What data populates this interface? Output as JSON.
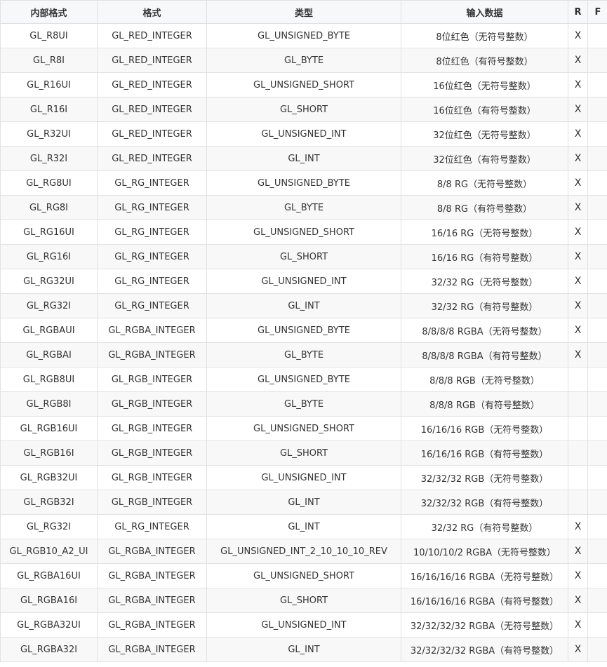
{
  "table": {
    "headers": [
      "内部格式",
      "格式",
      "类型",
      "输入数据",
      "R",
      "F"
    ],
    "rows": [
      [
        "GL_R8UI",
        "GL_RED_INTEGER",
        "GL_UNSIGNED_BYTE",
        "8位红色（无符号整数）",
        "X",
        ""
      ],
      [
        "GL_R8I",
        "GL_RED_INTEGER",
        "GL_BYTE",
        "8位红色（有符号整数）",
        "X",
        ""
      ],
      [
        "GL_R16UI",
        "GL_RED_INTEGER",
        "GL_UNSIGNED_SHORT",
        "16位红色（无符号整数）",
        "X",
        ""
      ],
      [
        "GL_R16I",
        "GL_RED_INTEGER",
        "GL_SHORT",
        "16位红色（有符号整数）",
        "X",
        ""
      ],
      [
        "GL_R32UI",
        "GL_RED_INTEGER",
        "GL_UNSIGNED_INT",
        "32位红色（无符号整数）",
        "X",
        ""
      ],
      [
        "GL_R32I",
        "GL_RED_INTEGER",
        "GL_INT",
        "32位红色（有符号整数）",
        "X",
        ""
      ],
      [
        "GL_RG8UI",
        "GL_RG_INTEGER",
        "GL_UNSIGNED_BYTE",
        "8/8 RG（无符号整数）",
        "X",
        ""
      ],
      [
        "GL_RG8I",
        "GL_RG_INTEGER",
        "GL_BYTE",
        "8/8 RG（有符号整数）",
        "X",
        ""
      ],
      [
        "GL_RG16UI",
        "GL_RG_INTEGER",
        "GL_UNSIGNED_SHORT",
        "16/16 RG（无符号整数）",
        "X",
        ""
      ],
      [
        "GL_RG16I",
        "GL_RG_INTEGER",
        "GL_SHORT",
        "16/16 RG（有符号整数）",
        "X",
        ""
      ],
      [
        "GL_RG32UI",
        "GL_RG_INTEGER",
        "GL_UNSIGNED_INT",
        "32/32 RG（无符号整数）",
        "X",
        ""
      ],
      [
        "GL_RG32I",
        "GL_RG_INTEGER",
        "GL_INT",
        "32/32 RG（有符号整数）",
        "X",
        ""
      ],
      [
        "GL_RGBAUI",
        "GL_RGBA_INTEGER",
        "GL_UNSIGNED_BYTE",
        "8/8/8/8 RGBA（无符号整数）",
        "X",
        ""
      ],
      [
        "GL_RGBAI",
        "GL_RGBA_INTEGER",
        "GL_BYTE",
        "8/8/8/8 RGBA（有符号整数）",
        "X",
        ""
      ],
      [
        "GL_RGB8UI",
        "GL_RGB_INTEGER",
        "GL_UNSIGNED_BYTE",
        "8/8/8 RGB（无符号整数）",
        "",
        ""
      ],
      [
        "GL_RGB8I",
        "GL_RGB_INTEGER",
        "GL_BYTE",
        "8/8/8 RGB（有符号整数）",
        "",
        ""
      ],
      [
        "GL_RGB16UI",
        "GL_RGB_INTEGER",
        "GL_UNSIGNED_SHORT",
        "16/16/16 RGB（无符号整数）",
        "",
        ""
      ],
      [
        "GL_RGB16I",
        "GL_RGB_INTEGER",
        "GL_SHORT",
        "16/16/16 RGB（有符号整数）",
        "",
        ""
      ],
      [
        "GL_RGB32UI",
        "GL_RGB_INTEGER",
        "GL_UNSIGNED_INT",
        "32/32/32 RGB（无符号整数）",
        "",
        ""
      ],
      [
        "GL_RGB32I",
        "GL_RGB_INTEGER",
        "GL_INT",
        "32/32/32 RGB（有符号整数）",
        "",
        ""
      ],
      [
        "GL_RG32I",
        "GL_RG_INTEGER",
        "GL_INT",
        "32/32 RG（有符号整数）",
        "X",
        ""
      ],
      [
        "GL_RGB10_A2_UI",
        "GL_RGBA_INTEGER",
        "GL_UNSIGNED_INT_2_10_10_10_REV",
        "10/10/10/2 RGBA（无符号整数）",
        "X",
        ""
      ],
      [
        "GL_RGBA16UI",
        "GL_RGBA_INTEGER",
        "GL_UNSIGNED_SHORT",
        "16/16/16/16 RGBA（无符号整数）",
        "X",
        ""
      ],
      [
        "GL_RGBA16I",
        "GL_RGBA_INTEGER",
        "GL_SHORT",
        "16/16/16/16 RGBA（有符号整数）",
        "X",
        ""
      ],
      [
        "GL_RGBA32UI",
        "GL_RGBA_INTEGER",
        "GL_UNSIGNED_INT",
        "32/32/32/32 RGBA（无符号整数）",
        "X",
        ""
      ],
      [
        "GL_RGBA32I",
        "GL_RGBA_INTEGER",
        "GL_INT",
        "32/32/32/32 RGBA（有符号整数）",
        "X",
        ""
      ]
    ]
  }
}
